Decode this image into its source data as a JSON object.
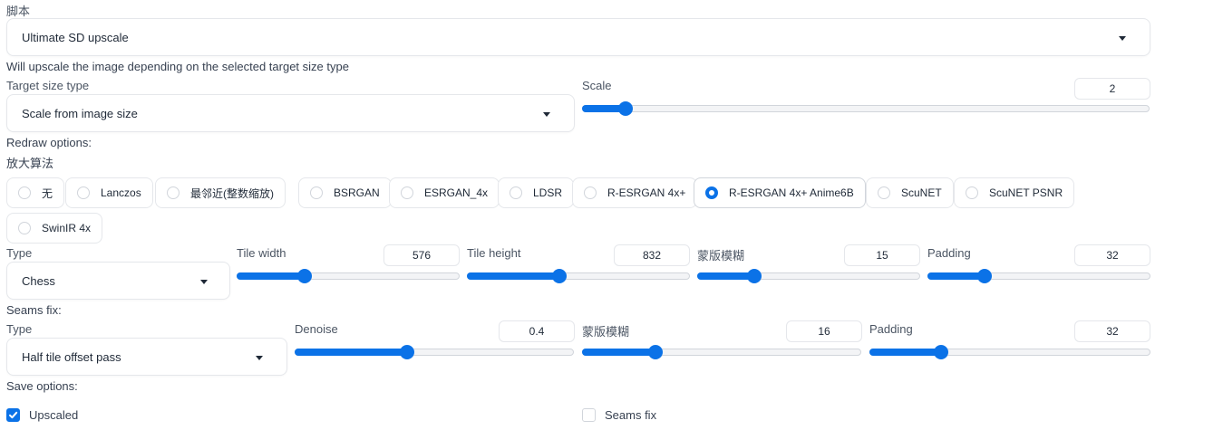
{
  "script": {
    "label": "脚本",
    "selected": "Ultimate SD upscale",
    "info": "Will upscale the image depending on the selected target size type"
  },
  "target_size": {
    "label": "Target size type",
    "selected": "Scale from image size",
    "scale_label": "Scale",
    "scale_value": "2",
    "scale_fraction": 0.075
  },
  "redraw": {
    "heading": "Redraw options:",
    "upscaler_label": "放大算法",
    "upscalers": [
      {
        "label": "无",
        "checked": false
      },
      {
        "label": "Lanczos",
        "checked": false
      },
      {
        "label": "最邻近(整数缩放)",
        "checked": false
      },
      {
        "label": "BSRGAN",
        "checked": false
      },
      {
        "label": "ESRGAN_4x",
        "checked": false
      },
      {
        "label": "LDSR",
        "checked": false
      },
      {
        "label": "R-ESRGAN 4x+",
        "checked": false
      },
      {
        "label": "R-ESRGAN 4x+ Anime6B",
        "checked": true
      },
      {
        "label": "ScuNET",
        "checked": false
      },
      {
        "label": "ScuNET PSNR",
        "checked": false
      },
      {
        "label": "SwinIR 4x",
        "checked": false
      }
    ],
    "type_label": "Type",
    "type_selected": "Chess",
    "tile_width": {
      "label": "Tile width",
      "value": "576",
      "fraction": 0.3
    },
    "tile_height": {
      "label": "Tile height",
      "value": "832",
      "fraction": 0.41
    },
    "mask_blur": {
      "label": "蒙版模糊",
      "value": "15",
      "fraction": 0.25
    },
    "padding": {
      "label": "Padding",
      "value": "32",
      "fraction": 0.25
    }
  },
  "seams": {
    "heading": "Seams fix:",
    "type_label": "Type",
    "type_selected": "Half tile offset pass",
    "denoise": {
      "label": "Denoise",
      "value": "0.4",
      "fraction": 0.4
    },
    "mask_blur": {
      "label": "蒙版模糊",
      "value": "16",
      "fraction": 0.26
    },
    "padding": {
      "label": "Padding",
      "value": "32",
      "fraction": 0.25
    }
  },
  "save": {
    "heading": "Save options:",
    "upscaled": {
      "label": "Upscaled",
      "checked": true
    },
    "seams_fix": {
      "label": "Seams fix",
      "checked": false
    }
  },
  "colors": {
    "accent": "#0b72e7"
  }
}
